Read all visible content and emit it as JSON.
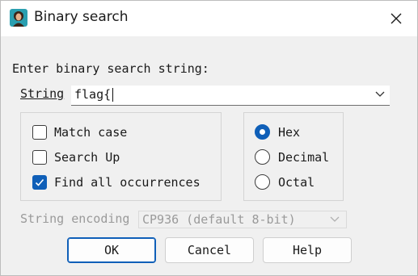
{
  "window": {
    "title": "Binary search",
    "icon": "ida-app-icon",
    "close_icon": "close-icon"
  },
  "prompt": "Enter binary search string:",
  "string_field": {
    "label": "String",
    "value": "flag{"
  },
  "options": {
    "match_case": {
      "label": "Match case",
      "checked": false
    },
    "search_up": {
      "label": "Search Up",
      "checked": false
    },
    "find_all": {
      "label": "Find all occurrences",
      "checked": true
    }
  },
  "radix": {
    "hex": {
      "label": "Hex",
      "selected": true
    },
    "decimal": {
      "label": "Decimal",
      "selected": false
    },
    "octal": {
      "label": "Octal",
      "selected": false
    }
  },
  "encoding": {
    "label": "String encoding",
    "value": "CP936 (default 8-bit)"
  },
  "buttons": {
    "ok": "OK",
    "cancel": "Cancel",
    "help": "Help"
  },
  "colors": {
    "accent": "#0f5fb8",
    "background": "#f0f0f0",
    "titlebar": "#ffffff"
  }
}
